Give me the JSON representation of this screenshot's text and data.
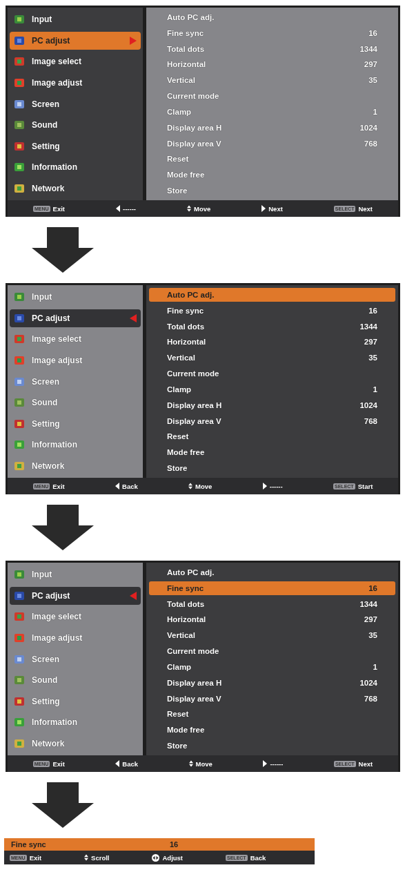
{
  "screens": [
    {
      "menu_focused": true,
      "menu": [
        {
          "label": "Input",
          "selected": false
        },
        {
          "label": "PC adjust",
          "selected": true
        },
        {
          "label": "Image select",
          "selected": false
        },
        {
          "label": "Image adjust",
          "selected": false
        },
        {
          "label": "Screen",
          "selected": false
        },
        {
          "label": "Sound",
          "selected": false
        },
        {
          "label": "Setting",
          "selected": false
        },
        {
          "label": "Information",
          "selected": false
        },
        {
          "label": "Network",
          "selected": false
        }
      ],
      "submenu": [
        {
          "label": "Auto PC adj.",
          "selected": false
        },
        {
          "label": "Fine sync",
          "value": "16",
          "selected": false
        },
        {
          "label": "Total dots",
          "value": "1344",
          "selected": false
        },
        {
          "label": "Horizontal",
          "value": "297",
          "selected": false
        },
        {
          "label": "Vertical",
          "value": "35",
          "selected": false
        },
        {
          "label": "Current mode",
          "selected": false
        },
        {
          "label": "Clamp",
          "value": "1",
          "selected": false
        },
        {
          "label": "Display area H",
          "value": "1024",
          "selected": false
        },
        {
          "label": "Display area V",
          "value": "768",
          "selected": false
        },
        {
          "label": "Reset",
          "selected": false
        },
        {
          "label": "Mode free",
          "selected": false
        },
        {
          "label": "Store",
          "selected": false
        }
      ],
      "hints": [
        {
          "kind": "key",
          "key": "MENU",
          "label": "Exit"
        },
        {
          "kind": "left",
          "label": "------"
        },
        {
          "kind": "updown",
          "label": "Move"
        },
        {
          "kind": "right",
          "label": "Next"
        },
        {
          "kind": "key",
          "key": "SELECT",
          "label": "Next"
        }
      ]
    },
    {
      "menu_focused": false,
      "menu": [
        {
          "label": "Input",
          "selected": false
        },
        {
          "label": "PC adjust",
          "selected": true
        },
        {
          "label": "Image select",
          "selected": false
        },
        {
          "label": "Image adjust",
          "selected": false
        },
        {
          "label": "Screen",
          "selected": false
        },
        {
          "label": "Sound",
          "selected": false
        },
        {
          "label": "Setting",
          "selected": false
        },
        {
          "label": "Information",
          "selected": false
        },
        {
          "label": "Network",
          "selected": false
        }
      ],
      "submenu": [
        {
          "label": "Auto PC adj.",
          "selected": true
        },
        {
          "label": "Fine sync",
          "value": "16",
          "selected": false
        },
        {
          "label": "Total dots",
          "value": "1344",
          "selected": false
        },
        {
          "label": "Horizontal",
          "value": "297",
          "selected": false
        },
        {
          "label": "Vertical",
          "value": "35",
          "selected": false
        },
        {
          "label": "Current mode",
          "selected": false
        },
        {
          "label": "Clamp",
          "value": "1",
          "selected": false
        },
        {
          "label": "Display area H",
          "value": "1024",
          "selected": false
        },
        {
          "label": "Display area V",
          "value": "768",
          "selected": false
        },
        {
          "label": "Reset",
          "selected": false
        },
        {
          "label": "Mode free",
          "selected": false
        },
        {
          "label": "Store",
          "selected": false
        }
      ],
      "hints": [
        {
          "kind": "key",
          "key": "MENU",
          "label": "Exit"
        },
        {
          "kind": "left",
          "label": "Back"
        },
        {
          "kind": "updown",
          "label": "Move"
        },
        {
          "kind": "right",
          "label": "------"
        },
        {
          "kind": "key",
          "key": "SELECT",
          "label": "Start"
        }
      ]
    },
    {
      "menu_focused": false,
      "menu": [
        {
          "label": "Input",
          "selected": false
        },
        {
          "label": "PC adjust",
          "selected": true
        },
        {
          "label": "Image select",
          "selected": false
        },
        {
          "label": "Image adjust",
          "selected": false
        },
        {
          "label": "Screen",
          "selected": false
        },
        {
          "label": "Sound",
          "selected": false
        },
        {
          "label": "Setting",
          "selected": false
        },
        {
          "label": "Information",
          "selected": false
        },
        {
          "label": "Network",
          "selected": false
        }
      ],
      "submenu": [
        {
          "label": "Auto PC adj.",
          "selected": false
        },
        {
          "label": "Fine sync",
          "value": "16",
          "selected": true
        },
        {
          "label": "Total dots",
          "value": "1344",
          "selected": false
        },
        {
          "label": "Horizontal",
          "value": "297",
          "selected": false
        },
        {
          "label": "Vertical",
          "value": "35",
          "selected": false
        },
        {
          "label": "Current mode",
          "selected": false
        },
        {
          "label": "Clamp",
          "value": "1",
          "selected": false
        },
        {
          "label": "Display area H",
          "value": "1024",
          "selected": false
        },
        {
          "label": "Display area V",
          "value": "768",
          "selected": false
        },
        {
          "label": "Reset",
          "selected": false
        },
        {
          "label": "Mode free",
          "selected": false
        },
        {
          "label": "Store",
          "selected": false
        }
      ],
      "hints": [
        {
          "kind": "key",
          "key": "MENU",
          "label": "Exit"
        },
        {
          "kind": "left",
          "label": "Back"
        },
        {
          "kind": "updown",
          "label": "Move"
        },
        {
          "kind": "right",
          "label": "------"
        },
        {
          "kind": "key",
          "key": "SELECT",
          "label": "Next"
        }
      ]
    }
  ],
  "adjust_bar": {
    "label": "Fine sync",
    "value": "16",
    "hints": [
      {
        "kind": "key",
        "key": "MENU",
        "label": "Exit"
      },
      {
        "kind": "updown",
        "label": "Scroll"
      },
      {
        "kind": "leftright",
        "label": "Adjust"
      },
      {
        "kind": "key",
        "key": "SELECT",
        "label": "Back"
      }
    ]
  }
}
